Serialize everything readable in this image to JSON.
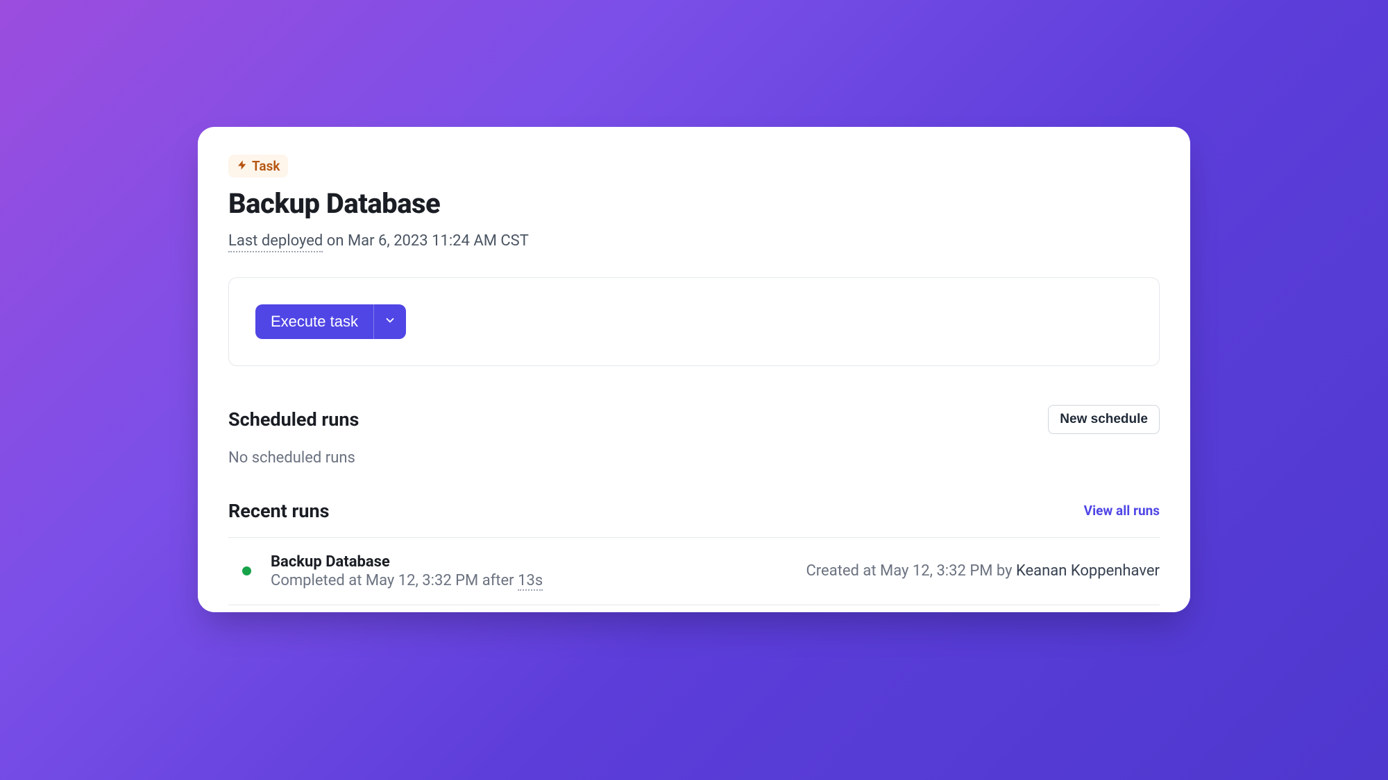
{
  "badge": {
    "label": "Task"
  },
  "pageTitle": "Backup Database",
  "deployed": {
    "label": "Last deployed",
    "suffix": " on Mar 6, 2023 11:24 AM CST"
  },
  "execute": {
    "buttonLabel": "Execute task"
  },
  "scheduled": {
    "heading": "Scheduled runs",
    "newButton": "New schedule",
    "empty": "No scheduled runs"
  },
  "recent": {
    "heading": "Recent runs",
    "viewAll": "View all runs",
    "runs": [
      {
        "name": "Backup Database",
        "completedPrefix": "Completed at May 12, 3:32 PM after ",
        "duration": "13s",
        "createdPrefix": "Created at ",
        "createdTime": "May 12, 3:32 PM",
        "byLabel": " by ",
        "author": "Keanan Koppenhaver"
      }
    ]
  }
}
